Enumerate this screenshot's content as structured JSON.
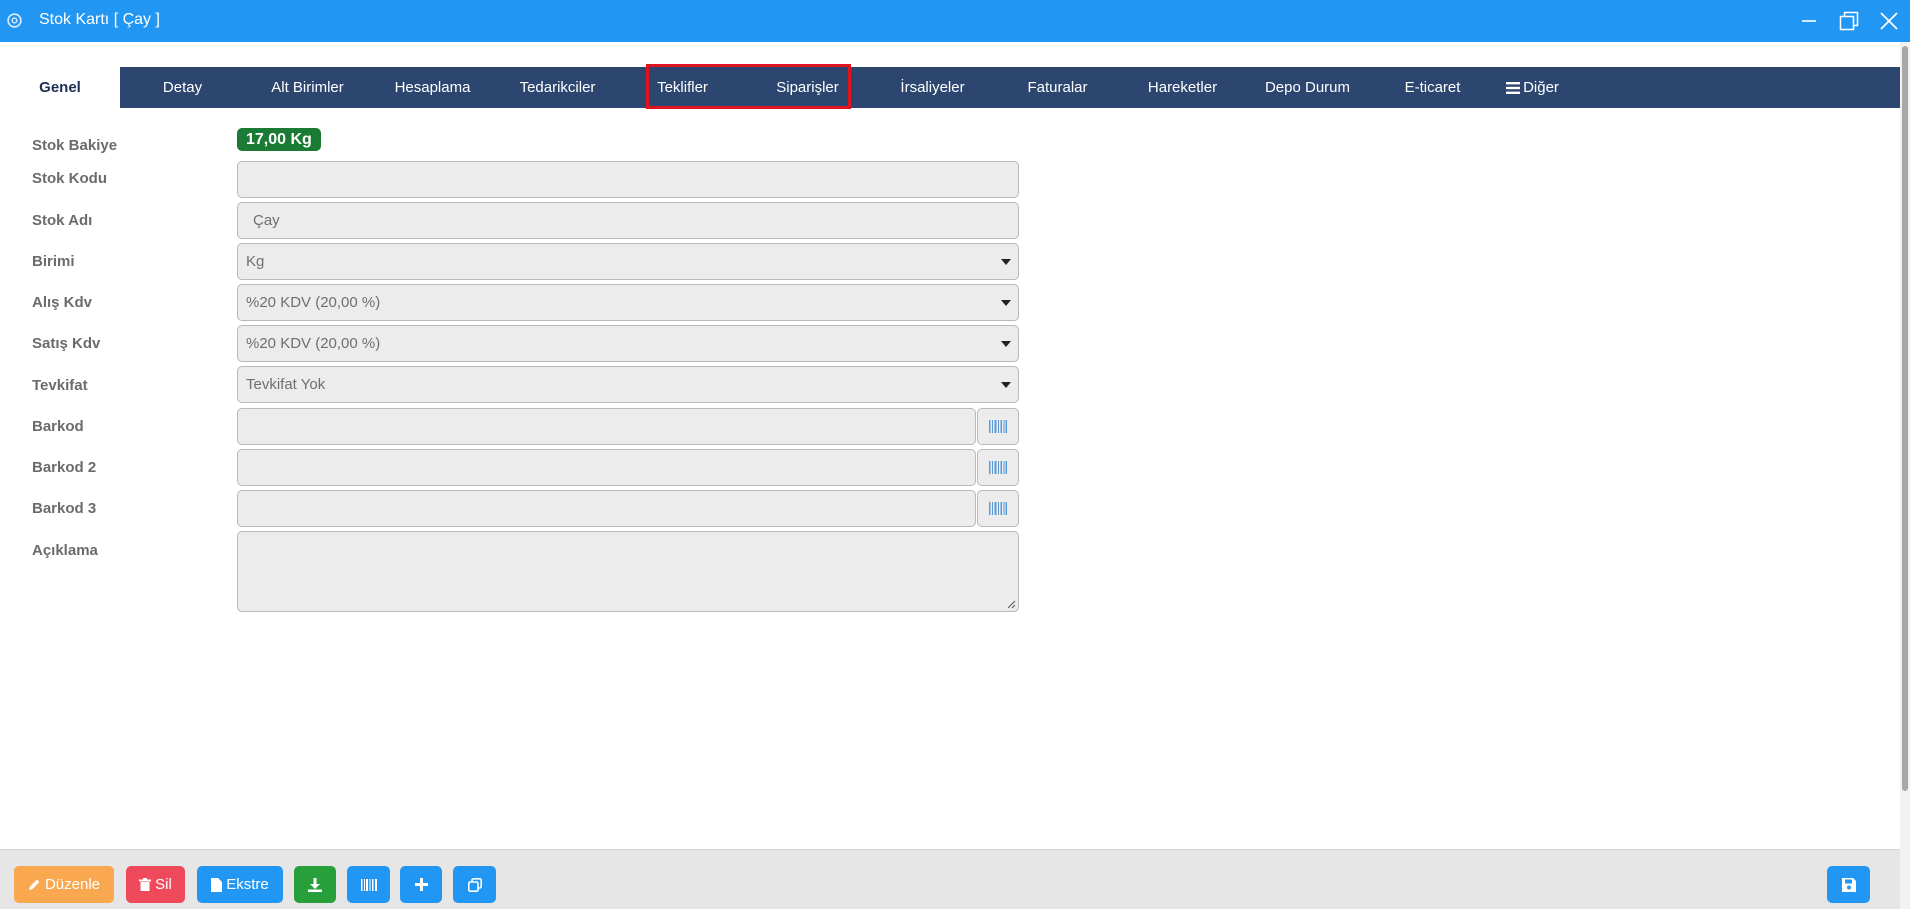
{
  "window": {
    "title": "Stok Kartı [ Çay ]",
    "title_color": "#2196f3"
  },
  "tabs": [
    {
      "label": "Genel",
      "active": true
    },
    {
      "label": "Detay"
    },
    {
      "label": "Alt Birimler"
    },
    {
      "label": "Hesaplama"
    },
    {
      "label": "Tedarikciler"
    },
    {
      "label": "Teklifler",
      "highlighted": true
    },
    {
      "label": "Siparişler",
      "highlighted": true
    },
    {
      "label": "İrsaliyeler"
    },
    {
      "label": "Faturalar"
    },
    {
      "label": "Hareketler"
    },
    {
      "label": "Depo Durum"
    },
    {
      "label": "E-ticaret"
    },
    {
      "label": "Diğer",
      "icon": "menu-icon"
    }
  ],
  "form": {
    "stok_bakiye": {
      "label": "Stok Bakiye",
      "value": "17,00 Kg"
    },
    "stok_kodu": {
      "label": "Stok Kodu",
      "value": ""
    },
    "stok_adi": {
      "label": "Stok Adı",
      "value": "Çay"
    },
    "birimi": {
      "label": "Birimi",
      "value": "Kg"
    },
    "alis_kdv": {
      "label": "Alış Kdv",
      "value": "%20 KDV (20,00 %)"
    },
    "satis_kdv": {
      "label": "Satış Kdv",
      "value": "%20 KDV (20,00 %)"
    },
    "tevkifat": {
      "label": "Tevkifat",
      "value": "Tevkifat Yok"
    },
    "barkod": {
      "label": "Barkod",
      "value": ""
    },
    "barkod2": {
      "label": "Barkod 2",
      "value": ""
    },
    "barkod3": {
      "label": "Barkod 3",
      "value": ""
    },
    "aciklama": {
      "label": "Açıklama",
      "value": ""
    }
  },
  "footer": {
    "edit_label": "Düzenle",
    "delete_label": "Sil",
    "statement_label": "Ekstre"
  },
  "colors": {
    "tabbar": "#2c4670",
    "balance_badge": "#1b7a33",
    "edit": "#f9a84f",
    "delete": "#ef4a5c",
    "blue": "#2196f3",
    "green": "#27a03c",
    "highlight": "#e0141e"
  }
}
